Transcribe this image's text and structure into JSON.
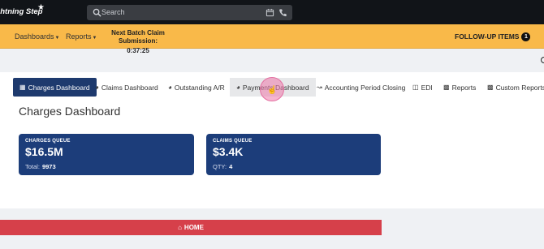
{
  "app": {
    "brand": "Lightning Step"
  },
  "search": {
    "placeholder": "Search"
  },
  "nav": {
    "dashboards": "Dashboards",
    "reports": "Reports",
    "batch_label": "Next Batch Claim Submission:",
    "batch_time": "0:37:25",
    "followup_label": "FOLLOW-UP ITEMS",
    "followup_count": "1"
  },
  "tabs": [
    {
      "label": "Charges Dashboard",
      "icon": "table-icon"
    },
    {
      "label": "Claims Dashboard",
      "icon": "dashboard-icon"
    },
    {
      "label": "Outstanding A/R",
      "icon": "dashboard-icon"
    },
    {
      "label": "Payments Dashboard",
      "icon": "dashboard-icon"
    },
    {
      "label": "Accounting Period Closing",
      "icon": "line-chart-icon"
    },
    {
      "label": "EDI",
      "icon": "file-icon"
    },
    {
      "label": "Reports",
      "icon": "bar-chart-icon"
    },
    {
      "label": "Custom Reports",
      "icon": "bar-chart-icon"
    }
  ],
  "page": {
    "title": "Charges Dashboard"
  },
  "stats": [
    {
      "label": "CHARGES QUEUE",
      "value": "$16.5M",
      "sub_label": "Total:",
      "sub_value": "9973"
    },
    {
      "label": "CLAIMS QUEUE",
      "value": "$3.4K",
      "sub_label": "QTY:",
      "sub_value": "4"
    }
  ],
  "home": {
    "label": "HOME"
  },
  "colors": {
    "nav_bar": "#f9b949",
    "tab_active": "#1e3a6e",
    "stat_card": "#1c3d7a",
    "home_button": "#d6404a",
    "topbar": "#111418"
  }
}
